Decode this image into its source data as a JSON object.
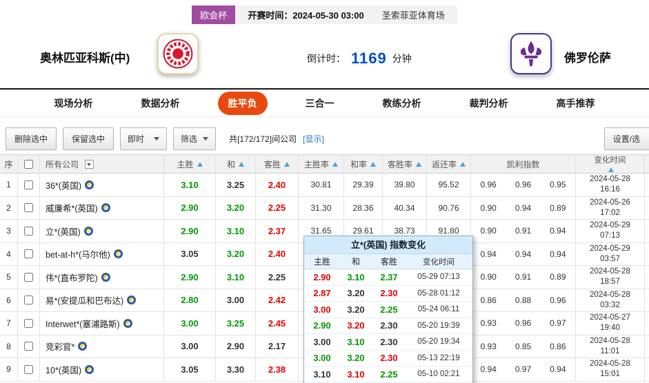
{
  "header": {
    "league": "欧会杯",
    "kickoff_label": "开赛时间：",
    "kickoff_value": "2024-05-30 03:00",
    "venue": "圣索菲亚体育场",
    "home_team": "奥林匹亚科斯(中)",
    "away_team": "佛罗伦萨",
    "countdown_label": "倒计时：",
    "countdown_minutes": "1169",
    "countdown_unit": "分钟"
  },
  "nav": {
    "tabs": [
      {
        "label": "现场分析",
        "state": ""
      },
      {
        "label": "数据分析",
        "state": ""
      },
      {
        "label": "胜平负",
        "state": "active"
      },
      {
        "label": "三合一",
        "state": ""
      },
      {
        "label": "教练分析",
        "state": ""
      },
      {
        "label": "裁判分析",
        "state": ""
      },
      {
        "label": "高手推荐",
        "state": ""
      }
    ]
  },
  "toolbar": {
    "delete_button": "删除选中",
    "keep_button": "保留选中",
    "time_select": "即时",
    "filter_select": "筛选",
    "count_text": "共[172/172]间公司",
    "show_link": "[显示]",
    "settings_button": "设置/选"
  },
  "table": {
    "headers": {
      "index": "序",
      "company": "所有公司",
      "home": "主胜",
      "draw": "和",
      "away": "客胜",
      "home_rate": "主胜率",
      "draw_rate": "和率",
      "away_rate": "客胜率",
      "return_rate": "返还率",
      "kelly": "凯利指数",
      "time": "变化时间"
    },
    "rows": [
      {
        "no": "1",
        "company": "36*(英国)",
        "home": "3.10",
        "home_t": "g",
        "draw": "3.25",
        "draw_t": "k",
        "away": "2.40",
        "away_t": "r",
        "home_rate": "30.81",
        "draw_rate": "29.39",
        "away_rate": "39.80",
        "return_rate": "95.52",
        "kelly": [
          "0.96",
          "0.96",
          "0.95"
        ],
        "date": "2024-05-28",
        "time": "16:16"
      },
      {
        "no": "2",
        "company": "威廉希*(英国)",
        "home": "2.90",
        "home_t": "g",
        "draw": "3.20",
        "draw_t": "g",
        "away": "2.25",
        "away_t": "r",
        "home_rate": "31.30",
        "draw_rate": "28.36",
        "away_rate": "40.34",
        "return_rate": "90.76",
        "kelly": [
          "0.90",
          "0.94",
          "0.89"
        ],
        "date": "2024-05-26",
        "time": "17:02"
      },
      {
        "no": "3",
        "company": "立*(英国)",
        "home": "2.90",
        "home_t": "g",
        "draw": "3.10",
        "draw_t": "g",
        "away": "2.37",
        "away_t": "r",
        "home_rate": "31.65",
        "draw_rate": "29.61",
        "away_rate": "38.73",
        "return_rate": "91.80",
        "kelly": [
          "0.90",
          "0.91",
          "0.94"
        ],
        "date": "2024-05-29",
        "time": "07:13"
      },
      {
        "no": "4",
        "company": "bet-at-h*(马尔他)",
        "home": "3.05",
        "home_t": "k",
        "draw": "3.20",
        "draw_t": "g",
        "away": "2.40",
        "away_t": "r",
        "home_rate": "",
        "draw_rate": "",
        "away_rate": "",
        "return_rate": "",
        "kelly": [
          "0.94",
          "0.94",
          "0.94"
        ],
        "date": "2024-05-29",
        "time": "03:57"
      },
      {
        "no": "5",
        "company": "伟*(直布罗陀)",
        "home": "2.90",
        "home_t": "g",
        "draw": "3.10",
        "draw_t": "g",
        "away": "2.25",
        "away_t": "k",
        "home_rate": "",
        "draw_rate": "",
        "away_rate": "",
        "return_rate": "",
        "kelly": [
          "0.90",
          "0.91",
          "0.89"
        ],
        "date": "2024-05-28",
        "time": "18:57"
      },
      {
        "no": "6",
        "company": "易*(安提瓜和巴布达)",
        "home": "2.80",
        "home_t": "g",
        "draw": "3.00",
        "draw_t": "k",
        "away": "2.42",
        "away_t": "r",
        "home_rate": "",
        "draw_rate": "",
        "away_rate": "",
        "return_rate": "",
        "kelly": [
          "0.86",
          "0.88",
          "0.96"
        ],
        "date": "2024-05-28",
        "time": "03:32"
      },
      {
        "no": "7",
        "company": "Interwet*(塞浦路斯)",
        "home": "3.00",
        "home_t": "g",
        "draw": "3.25",
        "draw_t": "g",
        "away": "2.45",
        "away_t": "r",
        "home_rate": "",
        "draw_rate": "",
        "away_rate": "",
        "return_rate": "",
        "kelly": [
          "0.93",
          "0.96",
          "0.97"
        ],
        "date": "2024-05-27",
        "time": "19:40"
      },
      {
        "no": "8",
        "company": "竞彩官*",
        "home": "3.00",
        "home_t": "k",
        "draw": "2.90",
        "draw_t": "k",
        "away": "2.17",
        "away_t": "k",
        "home_rate": "",
        "draw_rate": "",
        "away_rate": "",
        "return_rate": "",
        "kelly": [
          "0.93",
          "0.85",
          "0.86"
        ],
        "date": "2024-05-28",
        "time": "11:01"
      },
      {
        "no": "9",
        "company": "10*(英国)",
        "home": "3.05",
        "home_t": "k",
        "draw": "3.30",
        "draw_t": "k",
        "away": "2.38",
        "away_t": "r",
        "home_rate": "",
        "draw_rate": "",
        "away_rate": "",
        "return_rate": "",
        "kelly": [
          "0.94",
          "0.97",
          "0.94"
        ],
        "date": "2024-05-28",
        "time": "15:01"
      }
    ]
  },
  "popup": {
    "title": "立*(英国) 指数变化",
    "col_home": "主胜",
    "col_draw": "和",
    "col_away": "客胜",
    "col_time": "变化时间",
    "rows": [
      {
        "home": "2.90",
        "home_t": "r",
        "draw": "3.10",
        "draw_t": "g",
        "away": "2.37",
        "away_t": "g",
        "time": "05-29 07:13"
      },
      {
        "home": "2.87",
        "home_t": "r",
        "draw": "3.20",
        "draw_t": "k",
        "away": "2.30",
        "away_t": "r",
        "time": "05-28 01:12"
      },
      {
        "home": "3.00",
        "home_t": "r",
        "draw": "3.20",
        "draw_t": "k",
        "away": "2.25",
        "away_t": "g",
        "time": "05-24 06:11"
      },
      {
        "home": "2.90",
        "home_t": "g",
        "draw": "3.20",
        "draw_t": "r",
        "away": "2.30",
        "away_t": "k",
        "time": "05-20 19:39"
      },
      {
        "home": "3.00",
        "home_t": "k",
        "draw": "3.10",
        "draw_t": "g",
        "away": "2.30",
        "away_t": "k",
        "time": "05-20 19:34"
      },
      {
        "home": "3.00",
        "home_t": "g",
        "draw": "3.20",
        "draw_t": "g",
        "away": "2.30",
        "away_t": "r",
        "time": "05-13 22:19"
      },
      {
        "home": "3.10",
        "home_t": "k",
        "draw": "3.10",
        "draw_t": "r",
        "away": "2.25",
        "away_t": "g",
        "time": "05-10 02:21"
      }
    ]
  },
  "colors": {
    "odds_up_red": "#e60000",
    "odds_down_green": "#009900",
    "active_tab_orange": "#e8490f",
    "league_badge_purple": "#a04ca0",
    "countdown_blue": "#0050c8",
    "link_blue": "#2878b8"
  }
}
